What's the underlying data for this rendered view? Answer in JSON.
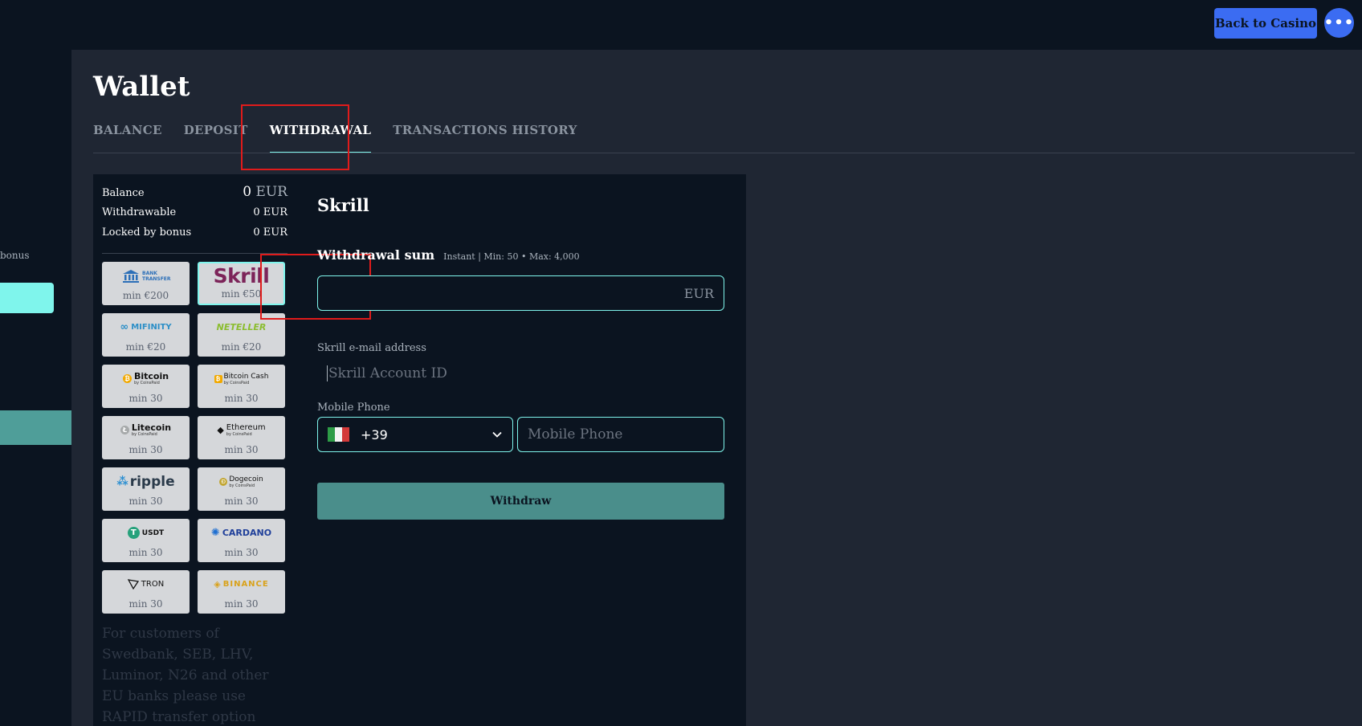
{
  "header": {
    "back_label": "Back to Casino",
    "more_icon": "more-dots-icon"
  },
  "sidebar": {
    "fragment_text": "bonus"
  },
  "page": {
    "title": "Wallet",
    "tabs": [
      {
        "label": "BALANCE",
        "active": false
      },
      {
        "label": "DEPOSIT",
        "active": false
      },
      {
        "label": "WITHDRAWAL",
        "active": true
      },
      {
        "label": "TRANSACTIONS HISTORY",
        "active": false
      }
    ]
  },
  "balances": {
    "balance_label": "Balance",
    "balance_value": "0",
    "balance_currency": "EUR",
    "withdrawable_label": "Withdrawable",
    "withdrawable_value": "0 EUR",
    "locked_label": "Locked by bonus",
    "locked_value": "0 EUR"
  },
  "methods": [
    {
      "name": "BANK TRANSFER",
      "min": "min €200"
    },
    {
      "name": "Skrill",
      "min": "min €50",
      "selected": true
    },
    {
      "name": "MIFINITY",
      "min": "min €20"
    },
    {
      "name": "NETELLER",
      "min": "min €20"
    },
    {
      "name": "Bitcoin",
      "min": "min 30"
    },
    {
      "name": "Bitcoin Cash",
      "min": "min 30"
    },
    {
      "name": "Litecoin",
      "min": "min 30"
    },
    {
      "name": "Ethereum",
      "min": "min 30"
    },
    {
      "name": "ripple",
      "min": "min 30"
    },
    {
      "name": "Dogecoin",
      "min": "min 30"
    },
    {
      "name": "USDT",
      "min": "min 30"
    },
    {
      "name": "CARDANO",
      "min": "min 30"
    },
    {
      "name": "TRON",
      "min": "min 30"
    },
    {
      "name": "BINANCE",
      "min": "min 30"
    }
  ],
  "logo_subtext": "by CoinsPaid",
  "note": "For customers of Swedbank, SEB, LHV, Luminor, N26 and other EU banks please use RAPID transfer option for instant bank transfer.",
  "form": {
    "title": "Skrill",
    "sum_label": "Withdrawal sum",
    "sum_info": "Instant | Min: 50 • Max: 4,000",
    "amount_value": "",
    "amount_currency": "EUR",
    "email_label": "Skrill e-mail address",
    "email_placeholder": "Skrill Account ID",
    "phone_label": "Mobile Phone",
    "country_code": "+39",
    "phone_placeholder": "Mobile Phone",
    "submit_label": "Withdraw"
  },
  "colors": {
    "accent": "#7ff5ec",
    "primary_button": "#3b6cf2",
    "withdraw_button": "#4a8e8b",
    "highlight": "#e01b1b"
  }
}
